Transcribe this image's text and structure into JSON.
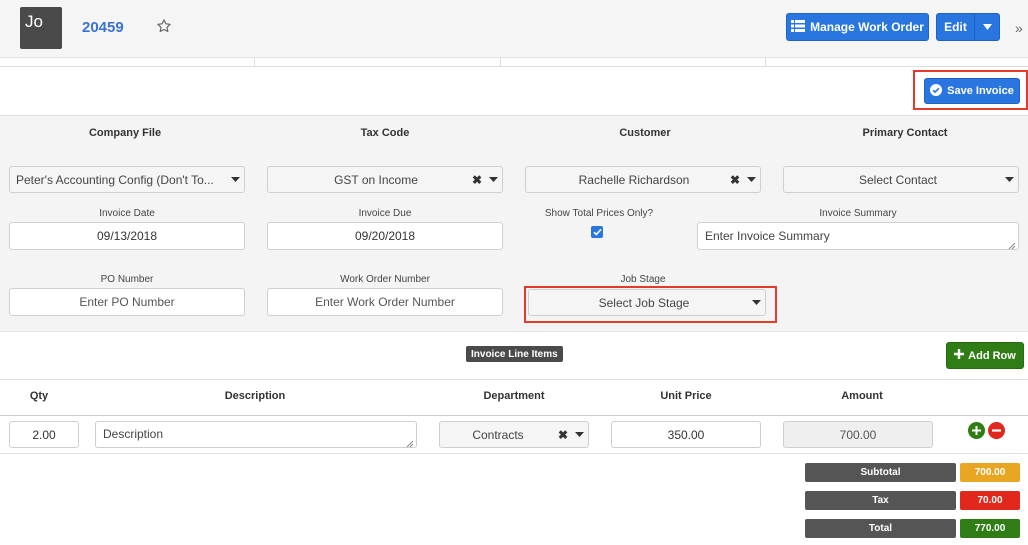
{
  "header": {
    "avatar_text": "Jo",
    "work_order_number": "20459",
    "manage_work_order_label": "Manage Work Order",
    "edit_label": "Edit"
  },
  "save_invoice_label": "Save Invoice",
  "form": {
    "company_file": {
      "label": "Company File",
      "value": "Peter's Accounting Config (Don't To..."
    },
    "tax_code": {
      "label": "Tax Code",
      "value": "GST on Income"
    },
    "customer": {
      "label": "Customer",
      "value": "Rachelle Richardson"
    },
    "primary_contact": {
      "label": "Primary Contact",
      "placeholder": "Select Contact"
    },
    "invoice_date": {
      "label": "Invoice Date",
      "value": "09/13/2018"
    },
    "invoice_due": {
      "label": "Invoice Due",
      "value": "09/20/2018"
    },
    "show_total_prices": {
      "label": "Show Total Prices Only?",
      "checked": true
    },
    "invoice_summary": {
      "label": "Invoice Summary",
      "placeholder": "Enter Invoice Summary"
    },
    "po_number": {
      "label": "PO Number",
      "placeholder": "Enter PO Number"
    },
    "work_order_number": {
      "label": "Work Order Number",
      "placeholder": "Enter Work Order Number"
    },
    "job_stage": {
      "label": "Job Stage",
      "placeholder": "Select Job Stage"
    }
  },
  "line_items": {
    "title": "Invoice Line Items",
    "add_row_label": "Add Row",
    "columns": [
      "Qty",
      "Description",
      "Department",
      "Unit Price",
      "Amount"
    ],
    "rows": [
      {
        "qty": "2.00",
        "description_placeholder": "Description",
        "department": "Contracts",
        "unit_price": "350.00",
        "amount": "700.00"
      }
    ]
  },
  "totals": {
    "subtotal_label": "Subtotal",
    "subtotal_value": "700.00",
    "tax_label": "Tax",
    "tax_value": "70.00",
    "total_label": "Total",
    "total_value": "770.00"
  },
  "colors": {
    "primary_blue": "#2a76e0",
    "success_green": "#2f7d14",
    "danger_red": "#e0281c",
    "subtotal_orange": "#e9a623",
    "highlight_red": "#e23b27"
  }
}
